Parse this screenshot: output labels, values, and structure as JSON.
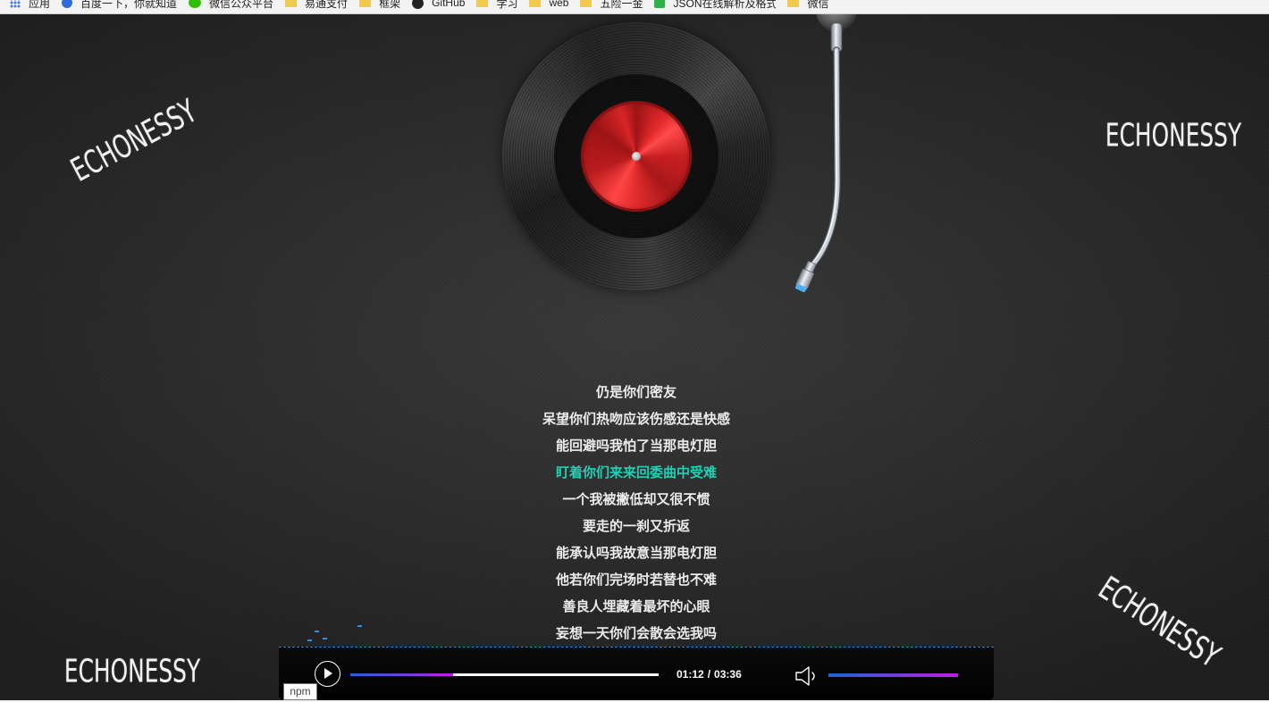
{
  "bookmarks": [
    {
      "label": "应用",
      "icon": "apps-grid-icon"
    },
    {
      "label": "百度一下，你就知道",
      "icon": "baidu-paw-icon"
    },
    {
      "label": "微信公众平台",
      "icon": "wechat-icon"
    },
    {
      "label": "易通支付",
      "icon": "folder-icon"
    },
    {
      "label": "框架",
      "icon": "folder-icon"
    },
    {
      "label": "GitHub",
      "icon": "github-icon"
    },
    {
      "label": "学习",
      "icon": "folder-icon"
    },
    {
      "label": "web",
      "icon": "folder-icon"
    },
    {
      "label": "五险一金",
      "icon": "folder-icon"
    },
    {
      "label": "JSON在线解析及格式",
      "icon": "json-icon"
    },
    {
      "label": "微信",
      "icon": "folder-icon"
    }
  ],
  "brand": {
    "text": "ECHONESSY"
  },
  "lyrics": {
    "lines": [
      "仍是你们密友",
      "呆望你们热吻应该伤感还是快感",
      "能回避吗我怕了当那电灯胆",
      "盯着你们来来回委曲中受难",
      "一个我被撇低却又很不惯",
      "要走的一刹又折返",
      "能承认吗我故意当那电灯胆",
      "他若你们完场时若替也不难",
      "善良人埋藏着最坏的心眼",
      "妄想一天你们会散会选我吗"
    ],
    "active_index": 3
  },
  "player": {
    "current_time": "01:12",
    "separator": "/",
    "total_time": "03:36",
    "progress_percent": 33.3,
    "volume_percent": 100,
    "play_icon": "play-icon",
    "volume_icon": "speaker-icon"
  },
  "tooltip": {
    "text": "npm"
  },
  "colors": {
    "active_lyric": "#1ed1b6",
    "progress_start": "#1a64d6",
    "progress_end": "#c21be3",
    "record_label": "#d8282a",
    "background": "#2d2d2d"
  }
}
